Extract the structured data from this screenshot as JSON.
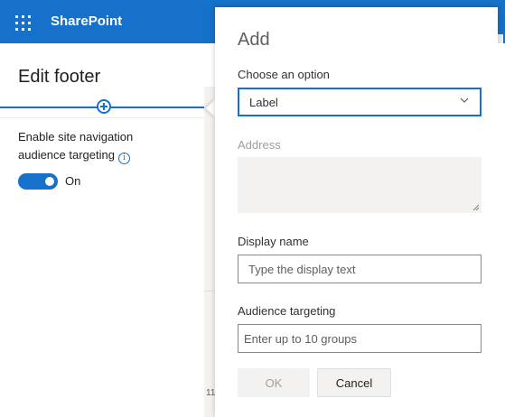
{
  "header": {
    "app_title": "SharePoint",
    "waffle_icon": "app-launcher-icon",
    "bar_color": "#1571c9"
  },
  "left_pane": {
    "title": "Edit footer",
    "setting_label": "Enable site navigation audience targeting",
    "info_icon_glyph": "i",
    "toggle_state": "On",
    "toggle_on": true
  },
  "background": {
    "partial_number": "11"
  },
  "add_panel": {
    "title": "Add",
    "choose_option": {
      "label": "Choose an option",
      "selected": "Label"
    },
    "address": {
      "label": "Address",
      "value": "",
      "disabled": true
    },
    "display_name": {
      "label": "Display name",
      "placeholder": "Type the display text",
      "value": ""
    },
    "audience": {
      "label": "Audience targeting",
      "placeholder": "Enter up to 10 groups",
      "value": ""
    },
    "buttons": {
      "ok": "OK",
      "cancel": "Cancel"
    }
  },
  "colors": {
    "accent": "#1571c9",
    "disabled_text": "#a19f9d",
    "field_bg": "#f3f2f1"
  }
}
